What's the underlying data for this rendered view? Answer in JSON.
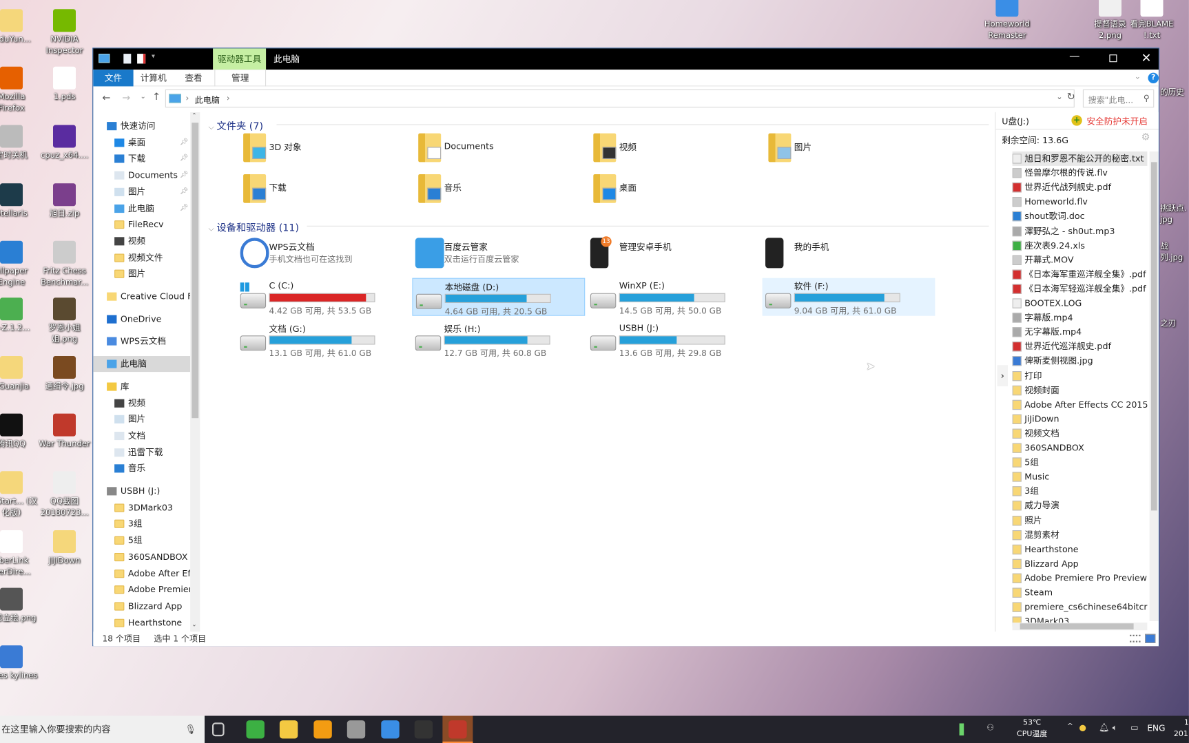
{
  "desktop": {
    "left_icons": [
      {
        "label": "aiduYun...",
        "color": "#f5d77b"
      },
      {
        "label": "NVIDIA Inspector",
        "color": "#76b900"
      },
      {
        "label": "Mozilla Firefox",
        "color": "#e66000"
      },
      {
        "label": "1.pds",
        "color": "#ffffff"
      },
      {
        "label": "定时关机",
        "color": "#bbbbbb"
      },
      {
        "label": "cpuz_x64....",
        "color": "#5a2ca0"
      },
      {
        "label": "Stellaris",
        "color": "#1d3b4a"
      },
      {
        "label": "旭日.zip",
        "color": "#7b3f8c"
      },
      {
        "label": "allpaper Engine",
        "color": "#2a7fd4"
      },
      {
        "label": "Fritz Chess Benchmar...",
        "color": "#cccccc"
      },
      {
        "label": "U-Z.1.2...",
        "color": "#4caf50"
      },
      {
        "label": "罗恩小姐姐.png",
        "color": "#5a4a30"
      },
      {
        "label": "nGuanjia",
        "color": "#f5d77b"
      },
      {
        "label": "通缉令.jpg",
        "color": "#7a4a20"
      },
      {
        "label": "腾讯QQ",
        "color": "#111111"
      },
      {
        "label": "War Thunder",
        "color": "#c0392b"
      },
      {
        "label": "DTStart... (汉化版)",
        "color": "#f5d77b"
      },
      {
        "label": "QQ截图 20180723...",
        "color": "#eeeeee"
      },
      {
        "label": "yberLink werDire...",
        "color": "#ffffff"
      },
      {
        "label": "JiJiDown",
        "color": "#f5d77b"
      },
      {
        "label": "罗恩立绘.png",
        "color": "#555555"
      },
      {
        "label": "",
        "color": ""
      },
      {
        "label": "Cities kylines",
        "color": "#3a7bd5"
      }
    ],
    "right_icons": [
      {
        "label": "Homeworld Remaster",
        "color": "#3a8ee6"
      },
      {
        "label": "提督语录 2.png",
        "color": "#f0f0f0"
      },
      {
        "label": "看完BLAME !.txt",
        "color": "#ffffff"
      }
    ],
    "edge_labels": [
      "的历史",
      "挑跃点. jpg",
      "战列.jpg",
      "之刃"
    ]
  },
  "taskbar": {
    "search_placeholder": "在这里输入你要搜索的内容",
    "apps": [
      {
        "name": "task-view",
        "color": "#555"
      },
      {
        "name": "360-browser",
        "color": "#3cb043"
      },
      {
        "name": "file-explorer",
        "color": "#f3c942"
      },
      {
        "name": "app-orange",
        "color": "#f39c12"
      },
      {
        "name": "app-camera",
        "color": "#999"
      },
      {
        "name": "app-blue-bird",
        "color": "#3a8ee6"
      },
      {
        "name": "obs",
        "color": "#333"
      },
      {
        "name": "app-active",
        "color": "#c0392b"
      }
    ],
    "cpu_temp": "53℃",
    "cpu_label": "CPU温度",
    "lang": "ENG",
    "clock_partial": "1",
    "date_partial": "201"
  },
  "window": {
    "title": "此电脑",
    "context_tab": "驱动器工具",
    "ribbon_tabs": [
      "文件",
      "计算机",
      "查看"
    ],
    "context_subtab": "管理",
    "address": [
      "此电脑"
    ],
    "search_placeholder": "搜索\"此电...",
    "nav": [
      {
        "label": "快速访问",
        "icon": "star",
        "indent": 0
      },
      {
        "label": "桌面",
        "icon": "desktop",
        "indent": 1,
        "pinned": true
      },
      {
        "label": "下载",
        "icon": "download",
        "indent": 1,
        "pinned": true
      },
      {
        "label": "Documents",
        "icon": "document",
        "indent": 1,
        "pinned": true
      },
      {
        "label": "图片",
        "icon": "picture",
        "indent": 1,
        "pinned": true
      },
      {
        "label": "此电脑",
        "icon": "computer",
        "indent": 1,
        "pinned": true
      },
      {
        "label": "FileRecv",
        "icon": "folder",
        "indent": 1
      },
      {
        "label": "视频",
        "icon": "video",
        "indent": 1
      },
      {
        "label": "视频文件",
        "icon": "folder",
        "indent": 1
      },
      {
        "label": "图片",
        "icon": "folder",
        "indent": 1
      },
      {
        "label": "Creative Cloud F",
        "icon": "creative-cloud",
        "indent": 0
      },
      {
        "label": "OneDrive",
        "icon": "onedrive",
        "indent": 0
      },
      {
        "label": "WPS云文档",
        "icon": "cloud",
        "indent": 0
      },
      {
        "label": "此电脑",
        "icon": "computer",
        "indent": 0,
        "selected": true
      },
      {
        "label": "库",
        "icon": "library",
        "indent": 0
      },
      {
        "label": "视频",
        "icon": "video",
        "indent": 1
      },
      {
        "label": "图片",
        "icon": "picture",
        "indent": 1
      },
      {
        "label": "文档",
        "icon": "document",
        "indent": 1
      },
      {
        "label": "迅雷下载",
        "icon": "download-folder",
        "indent": 1
      },
      {
        "label": "音乐",
        "icon": "music",
        "indent": 1
      },
      {
        "label": "USBH (J:)",
        "icon": "usb-drive",
        "indent": 0
      },
      {
        "label": "3DMark03",
        "icon": "folder",
        "indent": 1
      },
      {
        "label": "3组",
        "icon": "folder",
        "indent": 1
      },
      {
        "label": "5组",
        "icon": "folder",
        "indent": 1
      },
      {
        "label": "360SANDBOX",
        "icon": "folder",
        "indent": 1
      },
      {
        "label": "Adobe After Ef",
        "icon": "folder",
        "indent": 1
      },
      {
        "label": "Adobe Premier",
        "icon": "folder",
        "indent": 1
      },
      {
        "label": "Blizzard App",
        "icon": "folder",
        "indent": 1
      },
      {
        "label": "Hearthstone",
        "icon": "folder",
        "indent": 1
      }
    ],
    "folders_header": "文件夹 (7)",
    "folders": [
      {
        "label": "3D 对象",
        "overlay": "#3db5e6"
      },
      {
        "label": "Documents",
        "overlay": "#ffffff"
      },
      {
        "label": "视频",
        "overlay": "#333333"
      },
      {
        "label": "图片",
        "overlay": "#8fc3e8"
      },
      {
        "label": "下载",
        "overlay": "#2a7fd4"
      },
      {
        "label": "音乐",
        "overlay": "#2a7fd4"
      },
      {
        "label": "桌面",
        "overlay": "#1e88e5"
      }
    ],
    "devices_header": "设备和驱动器 (11)",
    "devices": [
      {
        "label": "WPS云文档",
        "sub": "手机文档也可在这找到",
        "icon": "cloud",
        "color": "#3a7bd5"
      },
      {
        "label": "百度云管家",
        "sub": "双击运行百度云管家",
        "icon": "baidu-cloud",
        "color": "#3a9ee6"
      },
      {
        "label": "管理安卓手机",
        "sub": "",
        "icon": "android-phone",
        "color": "#222222",
        "badge": "13"
      },
      {
        "label": "我的手机",
        "sub": "",
        "icon": "phone",
        "color": "#222222"
      }
    ],
    "drives": [
      {
        "label": "C (C:)",
        "free": "4.42 GB 可用, 共 53.5 GB",
        "used_fraction": 0.917,
        "color": "#da2626",
        "windows": true
      },
      {
        "label": "本地磁盘 (D:)",
        "free": "4.64 GB 可用, 共 20.5 GB",
        "used_fraction": 0.774,
        "color": "#26a0da",
        "state": "selected"
      },
      {
        "label": "WinXP (E:)",
        "free": "14.5 GB 可用, 共 50.0 GB",
        "used_fraction": 0.71,
        "color": "#26a0da"
      },
      {
        "label": "软件 (F:)",
        "free": "9.04 GB 可用, 共 61.0 GB",
        "used_fraction": 0.852,
        "color": "#26a0da",
        "state": "hover"
      },
      {
        "label": "文档 (G:)",
        "free": "13.1 GB 可用, 共 61.0 GB",
        "used_fraction": 0.785,
        "color": "#26a0da"
      },
      {
        "label": "娱乐 (H:)",
        "free": "12.7 GB 可用, 共 60.8 GB",
        "used_fraction": 0.791,
        "color": "#26a0da"
      },
      {
        "label": "USBH (J:)",
        "free": "13.6 GB 可用, 共 29.8 GB",
        "used_fraction": 0.544,
        "color": "#26a0da"
      }
    ],
    "status": {
      "count": "18 个项目",
      "selected": "选中 1 个项目"
    }
  },
  "usb_panel": {
    "title": "U盘(J:)",
    "security": "安全防护未开启",
    "free_space": "剩余空间: 13.6G",
    "files": [
      {
        "name": "旭日和罗恩不能公开的秘密.txt",
        "type": "txt"
      },
      {
        "name": "怪兽摩尔根的传说.flv",
        "type": "video"
      },
      {
        "name": "世界近代战列舰史.pdf",
        "type": "pdf"
      },
      {
        "name": "Homeworld.flv",
        "type": "video"
      },
      {
        "name": "shout歌词.doc",
        "type": "doc"
      },
      {
        "name": "澤野弘之 - sh0ut.mp3",
        "type": "media"
      },
      {
        "name": "座次表9.24.xls",
        "type": "xls"
      },
      {
        "name": "开幕式.MOV",
        "type": "video"
      },
      {
        "name": "《日本海军重巡洋舰全集》.pdf",
        "type": "pdf"
      },
      {
        "name": "《日本海军轻巡洋舰全集》.pdf",
        "type": "pdf"
      },
      {
        "name": "BOOTEX.LOG",
        "type": "txt"
      },
      {
        "name": "字幕版.mp4",
        "type": "media"
      },
      {
        "name": "无字幕版.mp4",
        "type": "media"
      },
      {
        "name": "世界近代巡洋舰史.pdf",
        "type": "pdf"
      },
      {
        "name": "俾斯麦侧视图.jpg",
        "type": "image"
      },
      {
        "name": "打印",
        "type": "folder"
      },
      {
        "name": "视频封面",
        "type": "folder"
      },
      {
        "name": "Adobe After Effects CC 2015",
        "type": "folder"
      },
      {
        "name": "JiJiDown",
        "type": "folder"
      },
      {
        "name": "视频文档",
        "type": "folder"
      },
      {
        "name": "360SANDBOX",
        "type": "folder"
      },
      {
        "name": "5组",
        "type": "folder"
      },
      {
        "name": "Music",
        "type": "folder"
      },
      {
        "name": "3组",
        "type": "folder"
      },
      {
        "name": "威力导演",
        "type": "folder"
      },
      {
        "name": "照片",
        "type": "folder"
      },
      {
        "name": "混剪素材",
        "type": "folder"
      },
      {
        "name": "Hearthstone",
        "type": "folder"
      },
      {
        "name": "Blizzard App",
        "type": "folder"
      },
      {
        "name": "Adobe Premiere Pro Preview ...",
        "type": "folder"
      },
      {
        "name": "Steam",
        "type": "folder"
      },
      {
        "name": "premiere_cs6chinese64bitcrac...",
        "type": "folder"
      },
      {
        "name": "3DMark03",
        "type": "folder"
      }
    ]
  },
  "colors": {
    "accent": "#1979ca",
    "context_tab": "#c6efa3",
    "selected": "#cce8ff",
    "hover": "#e5f3ff",
    "warning": "#e53935"
  }
}
